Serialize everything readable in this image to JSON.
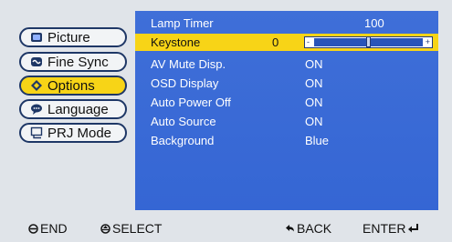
{
  "menu": {
    "items": [
      {
        "label": "Picture",
        "icon": "picture-icon"
      },
      {
        "label": "Fine Sync",
        "icon": "fine-sync-icon"
      },
      {
        "label": "Options",
        "icon": "options-icon",
        "active": true
      },
      {
        "label": "Language",
        "icon": "language-icon"
      },
      {
        "label": "PRJ Mode",
        "icon": "prj-mode-icon"
      }
    ]
  },
  "options": {
    "rows": [
      {
        "label": "Lamp Timer",
        "value": "100"
      },
      {
        "label": "Keystone",
        "value": "0",
        "selected": true,
        "slider_level": 0.5
      },
      {
        "label": "AV Mute Disp.",
        "value": "ON"
      },
      {
        "label": "OSD Display",
        "value": "ON"
      },
      {
        "label": "Auto Power Off",
        "value": "ON"
      },
      {
        "label": "Auto Source",
        "value": "ON"
      },
      {
        "label": "Background",
        "value": "Blue"
      }
    ],
    "slider_minus": "-",
    "slider_plus": "+"
  },
  "footer": {
    "end": "END",
    "select": "SELECT",
    "back": "BACK",
    "enter": "ENTER"
  },
  "colors": {
    "panel_blue": "#3566d4",
    "highlight_yellow": "#f7d417",
    "osd_gray": "#e0e4e9",
    "outline_navy": "#1e3766"
  }
}
